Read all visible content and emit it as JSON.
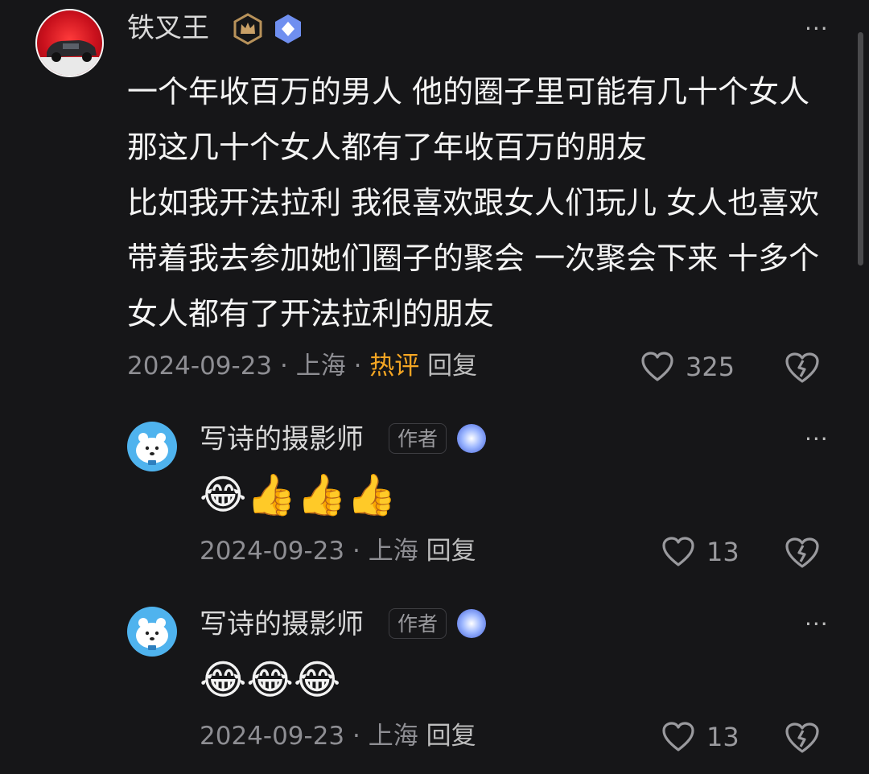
{
  "main_comment": {
    "username": "铁叉王",
    "text": "一个年收百万的男人 他的圈子里可能有几十个女人 那这几十个女人都有了年收百万的朋友\n比如我开法拉利 我很喜欢跟女人们玩儿 女人也喜欢带着我去参加她们圈子的聚会 一次聚会下来 十多个女人都有了开法拉利的朋友",
    "date": "2024-09-23",
    "location": "上海",
    "hot_label": "热评",
    "reply_label": "回复",
    "likes": "325",
    "more": "···"
  },
  "replies": [
    {
      "username": "写诗的摄影师",
      "author_tag": "作者",
      "emojis": "😂👍👍👍",
      "date": "2024-09-23",
      "location": "上海",
      "reply_label": "回复",
      "likes": "13",
      "more": "···"
    },
    {
      "username": "写诗的摄影师",
      "author_tag": "作者",
      "emojis": "😂😂😂",
      "date": "2024-09-23",
      "location": "上海",
      "reply_label": "回复",
      "likes": "13",
      "more": "···"
    }
  ],
  "meta_separator": " · ",
  "colors": {
    "background": "#161618",
    "hot": "#f5a623",
    "meta": "#8e8e93"
  },
  "icons": {
    "like": "heart-outline-icon",
    "dislike": "broken-heart-icon",
    "more": "more-dots-icon"
  }
}
